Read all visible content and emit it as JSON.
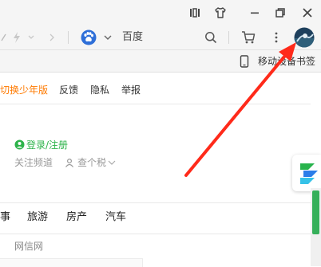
{
  "address_bar": {
    "search_engine": "百度"
  },
  "bookmark_bar": {
    "mobile_bookmarks": "移动设备书签"
  },
  "links": {
    "kids": "切换少年版",
    "feedback": "反馈",
    "privacy": "隐私",
    "report": "举报"
  },
  "user": {
    "login": "登录/注册",
    "follow_channels": "关注频道",
    "tax": "查个税"
  },
  "nav_tabs": [
    "事",
    "旅游",
    "房产",
    "汽车"
  ],
  "feed": {
    "source": "网信网"
  },
  "colors": {
    "orange": "#ff7a00",
    "green": "#2db34a",
    "annotation": "#ff2a1a",
    "search_engine_blue": "#2e6fd8"
  }
}
